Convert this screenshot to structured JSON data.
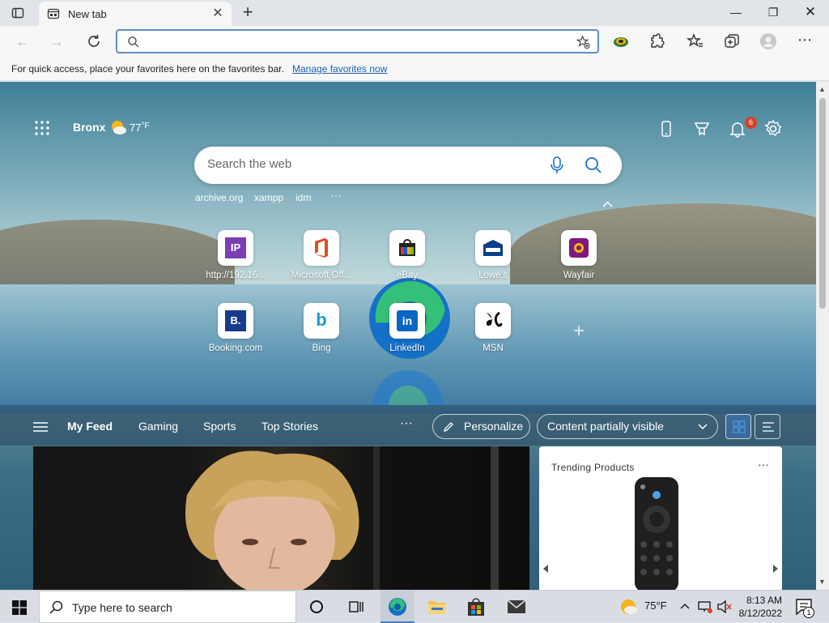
{
  "browser": {
    "tab": {
      "title": "New tab"
    },
    "address": {
      "value": "",
      "placeholder": ""
    },
    "favorites_bar": {
      "message": "For quick access, place your favorites here on the favorites bar.",
      "link": "Manage favorites now"
    }
  },
  "newtab": {
    "weather": {
      "city": "Bronx",
      "temp": "77",
      "unit": "°F"
    },
    "notifications_count": "6",
    "search": {
      "placeholder": "Search the web"
    },
    "quick_searches": [
      "archive.org",
      "xampp",
      "idm"
    ],
    "quick_more": "···",
    "tiles": [
      {
        "label": "http://192.16...",
        "icon": "ip-icon",
        "glyph": "IP",
        "color": "#7b3fb4"
      },
      {
        "label": "Microsoft Off...",
        "icon": "office-icon",
        "glyph": "",
        "color": "#e04e1f"
      },
      {
        "label": "eBay",
        "icon": "ebay-bag-icon",
        "glyph": "",
        "color": "#222"
      },
      {
        "label": "Lowe's",
        "icon": "lowes-icon",
        "glyph": "",
        "color": "#0a3f8c"
      },
      {
        "label": "Wayfair",
        "icon": "wayfair-icon",
        "glyph": "",
        "color": "#7f187f"
      },
      {
        "label": "Booking.com",
        "icon": "booking-icon",
        "glyph": "B.",
        "color": "#163b8c"
      },
      {
        "label": "Bing",
        "icon": "bing-icon",
        "glyph": "b",
        "color": "#1a9ad6"
      },
      {
        "label": "LinkedIn",
        "icon": "linkedin-icon",
        "glyph": "in",
        "color": "#0a66c2"
      },
      {
        "label": "MSN",
        "icon": "msn-icon",
        "glyph": "",
        "color": "#111"
      }
    ],
    "feed": {
      "tabs": [
        "My Feed",
        "Gaming",
        "Sports",
        "Top Stories"
      ],
      "more": "···",
      "personalize": "Personalize",
      "content_visibility": "Content partially visible",
      "trending": {
        "title": "Trending Products",
        "more": "···"
      }
    }
  },
  "taskbar": {
    "search_placeholder": "Type here to search",
    "weather": "75°F",
    "time": "8:13 AM",
    "date": "8/12/2022",
    "notification_count": "1"
  }
}
